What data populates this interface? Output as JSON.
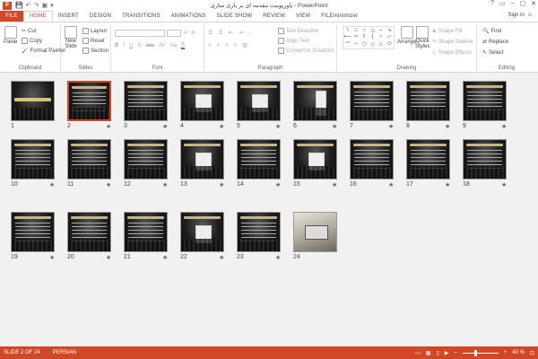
{
  "window": {
    "title": "پاورپوینت مقدمه ای بر بازی سازی - PowerPoint",
    "app_icon": "P",
    "controls": [
      "?",
      "▭",
      "–",
      "▢",
      "✕"
    ]
  },
  "quick_access": [
    "💾",
    "↶",
    "↷",
    "▣",
    "▾"
  ],
  "tabs": [
    {
      "label": "FILE",
      "kind": "file"
    },
    {
      "label": "HOME",
      "kind": "active"
    },
    {
      "label": "INSERT"
    },
    {
      "label": "DESIGN"
    },
    {
      "label": "TRANSITIONS"
    },
    {
      "label": "ANIMATIONS"
    },
    {
      "label": "SLIDE SHOW"
    },
    {
      "label": "REVIEW"
    },
    {
      "label": "VIEW"
    },
    {
      "label": "FILEminimizer"
    }
  ],
  "signin": {
    "label": "Sign in",
    "icon": "user-icon"
  },
  "ribbon": {
    "clipboard": {
      "label": "Clipboard",
      "paste": "Paste",
      "cut": "Cut",
      "copy": "Copy",
      "format_painter": "Format Painter"
    },
    "slides": {
      "label": "Slides",
      "new_slide": "New",
      "new_slide2": "Slide",
      "layout": "Layout",
      "reset": "Reset",
      "section": "Section"
    },
    "font": {
      "label": "Font",
      "buttons": [
        "B",
        "I",
        "U",
        "S",
        "abc",
        "AV",
        "Aa",
        "A"
      ]
    },
    "paragraph": {
      "label": "Paragraph",
      "text_direction": "Text Direction",
      "align_text": "Align Text",
      "convert_smartart": "Convert to SmartArt"
    },
    "drawing": {
      "label": "Drawing",
      "arrange": "Arrange",
      "quick_styles": "Quick",
      "quick_styles2": "Styles",
      "shape_fill": "Shape Fill",
      "shape_outline": "Shape Outline",
      "shape_effects": "Shape Effects",
      "shapes": [
        "\\",
        "□",
        "○",
        "△",
        "⌐",
        "↘",
        "⟵",
        "⇨",
        "⇧",
        "{",
        "☆",
        "▱",
        "⌒",
        "⌐",
        "⬡",
        "◇",
        "⊂",
        "⬭"
      ]
    },
    "editing": {
      "label": "Editing",
      "find": "Find",
      "replace": "Replace",
      "select": "Select"
    }
  },
  "slides": [
    {
      "n": "1",
      "star": "",
      "kind": "title"
    },
    {
      "n": "2",
      "star": "★",
      "kind": "text",
      "selected": true
    },
    {
      "n": "3",
      "star": "★",
      "kind": "text"
    },
    {
      "n": "4",
      "star": "★",
      "kind": "diagram"
    },
    {
      "n": "5",
      "star": "★",
      "kind": "diagram"
    },
    {
      "n": "6",
      "star": "★",
      "kind": "table"
    },
    {
      "n": "7",
      "star": "★",
      "kind": "text"
    },
    {
      "n": "8",
      "star": "★",
      "kind": "text"
    },
    {
      "n": "9",
      "star": "★",
      "kind": "text"
    },
    {
      "n": "10",
      "star": "★",
      "kind": "text"
    },
    {
      "n": "11",
      "star": "★",
      "kind": "text"
    },
    {
      "n": "12",
      "star": "★",
      "kind": "text"
    },
    {
      "n": "13",
      "star": "★",
      "kind": "diagram"
    },
    {
      "n": "14",
      "star": "★",
      "kind": "text"
    },
    {
      "n": "15",
      "star": "★",
      "kind": "diagram"
    },
    {
      "n": "16",
      "star": "★",
      "kind": "text"
    },
    {
      "n": "17",
      "star": "★",
      "kind": "text"
    },
    {
      "n": "18",
      "star": "★",
      "kind": "text"
    },
    {
      "n": "19",
      "star": "★",
      "kind": "text"
    },
    {
      "n": "20",
      "star": "★",
      "kind": "text"
    },
    {
      "n": "21",
      "star": "★",
      "kind": "text"
    },
    {
      "n": "22",
      "star": "★",
      "kind": "diagram"
    },
    {
      "n": "23",
      "star": "★",
      "kind": "text"
    },
    {
      "n": "24",
      "star": "",
      "kind": "photo"
    }
  ],
  "status": {
    "slide_info": "SLIDE 2 OF 24",
    "language": "PERSIAN",
    "zoom": "40 %",
    "zoom_minus": "–",
    "zoom_plus": "+"
  }
}
